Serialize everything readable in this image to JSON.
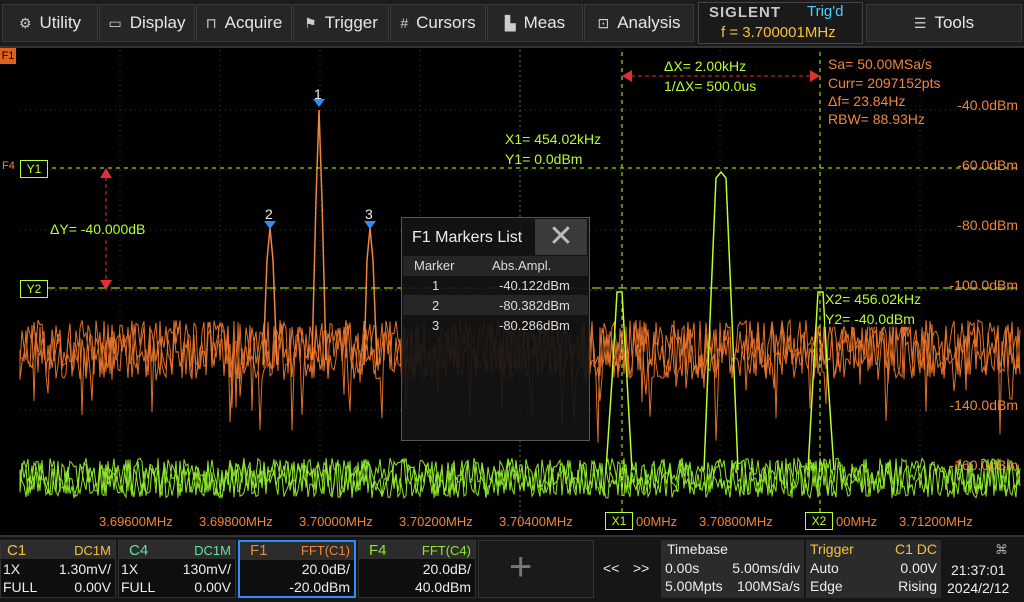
{
  "menu": {
    "utility": "Utility",
    "display": "Display",
    "acquire": "Acquire",
    "trigger": "Trigger",
    "cursors": "Cursors",
    "meas": "Meas",
    "analysis": "Analysis",
    "tools": "Tools"
  },
  "brand": "SIGLENT",
  "trig_status": "Trig'd",
  "freq_readout": "f = 3.700001MHz",
  "plot": {
    "f1_tag": "F1",
    "f4_tag": "F4",
    "sa": "Sa=  50.00MSa/s",
    "curr": "Curr= 2097152pts",
    "delta_f": "Δf=  23.84Hz",
    "rbw": "RBW=  88.93Hz",
    "y_labels": [
      "-40.0dBm",
      "-60.0dBm",
      "-80.0dBm",
      "-100.0dBm",
      "-140.0dBm",
      "-160.0dBm"
    ],
    "x_labels": [
      "3.69600MHz",
      "3.69800MHz",
      "3.70000MHz",
      "3.70200MHz",
      "3.70400MHz",
      "00MHz",
      "3.70800MHz",
      "00MHz",
      "3.71200MHz"
    ],
    "delta_x": "ΔX= 2.00kHz",
    "inv_delta_x": "1/ΔX= 500.0us",
    "x1": "X1= 454.02kHz",
    "y1": "Y1= 0.0dBm",
    "x2": "X2= 456.02kHz",
    "y2": "Y2= -40.0dBm",
    "delta_y": "ΔY= -40.000dB",
    "y1_box": "Y1",
    "y2_box": "Y2",
    "x1_box": "X1",
    "x2_box": "X2",
    "peak_labels": [
      "1",
      "2",
      "3"
    ]
  },
  "markers_list": {
    "title": "F1 Markers List",
    "col_marker": "Marker",
    "col_ampl": "Abs.Ampl.",
    "rows": [
      {
        "marker": "1",
        "ampl": "-40.122dBm"
      },
      {
        "marker": "2",
        "ampl": "-80.382dBm"
      },
      {
        "marker": "3",
        "ampl": "-80.286dBm"
      }
    ]
  },
  "channels": {
    "c1": {
      "name": "C1",
      "coupling": "DC1M",
      "probe": "1X",
      "scale": "1.30mV/",
      "bw": "FULL",
      "offset": "0.00V"
    },
    "c4": {
      "name": "C4",
      "coupling": "DC1M",
      "probe": "1X",
      "scale": "130mV/",
      "bw": "FULL",
      "offset": "0.00V"
    },
    "f1": {
      "name": "F1",
      "func": "FFT(C1)",
      "scale": "20.0dB/",
      "ref": "-20.0dBm"
    },
    "f4": {
      "name": "F4",
      "func": "FFT(C4)",
      "scale": "20.0dB/",
      "ref": "40.0dBm"
    }
  },
  "nav": {
    "prev": "<<",
    "next": ">>"
  },
  "timebase": {
    "label": "Timebase",
    "delay": "0.00s",
    "scale": "5.00ms/div",
    "mem": "5.00Mpts",
    "rate": "100MSa/s"
  },
  "trigger": {
    "label": "Trigger",
    "source": "C1 DC",
    "mode": "Auto",
    "level": "0.00V",
    "type": "Edge",
    "slope": "Rising"
  },
  "clock": {
    "time": "21:37:01",
    "date": "2024/2/12"
  },
  "colors": {
    "f1": "#f0863c",
    "f4": "#8ee62a",
    "cursor": "#b8ff2c",
    "accent": "#2f8cff"
  }
}
